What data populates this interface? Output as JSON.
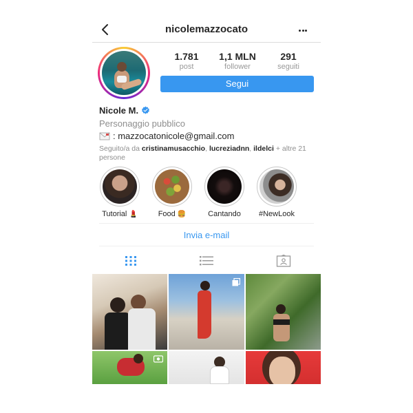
{
  "header": {
    "username": "nicolemazzocato",
    "back_icon": "chevron-left-icon",
    "more_icon": "more-dots-icon"
  },
  "stats": [
    {
      "value": "1.781",
      "label": "post"
    },
    {
      "value": "1,1 MLN",
      "label": "follower"
    },
    {
      "value": "291",
      "label": "seguiti"
    }
  ],
  "follow_button": "Segui",
  "bio": {
    "name": "Nicole M.",
    "verified_icon": "verified-badge-icon",
    "category": "Personaggio pubblico",
    "email_icon": "envelope-icon",
    "email": ": mazzocatonicole@gmail.com",
    "followed_prefix": "Seguito/a da ",
    "followed_names": [
      "cristinamusacchio",
      "lucreziadnn",
      "ildelci"
    ],
    "followed_sep": ", ",
    "followed_suffix": " + altre 21 persone"
  },
  "highlights": [
    {
      "label": "Tutorial",
      "emoji": "💄"
    },
    {
      "label": "Food",
      "emoji": "🍔"
    },
    {
      "label": "Cantando",
      "emoji": ""
    },
    {
      "label": "#NewLook",
      "emoji": ""
    }
  ],
  "email_action": "Invia e-mail",
  "tabs": [
    "grid-icon",
    "list-icon",
    "tagged-icon"
  ],
  "colors": {
    "accent": "#3897f0",
    "text": "#262626",
    "muted": "#8e8e8e"
  }
}
